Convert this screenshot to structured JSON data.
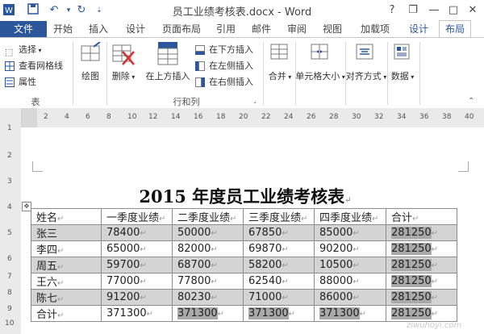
{
  "window": {
    "title": "员工业绩考核表.docx - Word"
  },
  "qat": {
    "save_icon": "floppy-disk-icon",
    "undo_icon": "undo-icon",
    "redo_icon": "redo-icon"
  },
  "window_controls": {
    "help": "?",
    "restore": "❐",
    "minimize": "—",
    "maximize": "□",
    "close": "✕"
  },
  "tabs": [
    {
      "label": "文件"
    },
    {
      "label": "开始"
    },
    {
      "label": "插入"
    },
    {
      "label": "设计"
    },
    {
      "label": "页面布局"
    },
    {
      "label": "引用"
    },
    {
      "label": "邮件"
    },
    {
      "label": "审阅"
    },
    {
      "label": "视图"
    },
    {
      "label": "加载项"
    },
    {
      "label": "设计"
    },
    {
      "label": "布局"
    }
  ],
  "ribbon": {
    "table_group": {
      "select": "选择",
      "view_gridlines": "查看网格线",
      "properties": "属性",
      "label": "表"
    },
    "draw": "绘图",
    "delete": "删除",
    "insert_above": "在上方插入",
    "insert_below": "在下方插入",
    "insert_left": "在左侧插入",
    "insert_right": "在右侧插入",
    "rows_cols_label": "行和列",
    "merge": "合并",
    "cell_size": "单元格大小",
    "alignment": "对齐方式",
    "data": "数据"
  },
  "ruler": {
    "h_ticks": [
      "2",
      "4",
      "6",
      "8",
      "10",
      "12",
      "14",
      "16",
      "18",
      "20",
      "22",
      "24",
      "26",
      "28",
      "30",
      "32",
      "34",
      "36",
      "38",
      "40"
    ],
    "v_ticks": [
      "1",
      "2",
      "3",
      "4",
      "5",
      "6",
      "7",
      "8",
      "9",
      "10",
      "11"
    ]
  },
  "document": {
    "title": "2015 年度员工业绩考核表",
    "headers": [
      "姓名",
      "一季度业绩",
      "二季度业绩",
      "三季度业绩",
      "四季度业绩",
      "合计"
    ],
    "rows": [
      [
        "张三",
        "78400",
        "50000",
        "67850",
        "85000",
        "281250"
      ],
      [
        "李四",
        "65000",
        "82000",
        "69870",
        "90200",
        "281250"
      ],
      [
        "周五",
        "59700",
        "68700",
        "58200",
        "10500",
        "281250"
      ],
      [
        "王六",
        "77000",
        "77800",
        "62540",
        "88000",
        "281250"
      ],
      [
        "陈七",
        "91200",
        "80230",
        "71000",
        "86000",
        "281250"
      ]
    ],
    "total_row": [
      "合计",
      "371300",
      "371300",
      "371300",
      "371300",
      "281250"
    ],
    "paragraph_mark": "↵"
  },
  "colors": {
    "accent": "#2b579a",
    "shade": "#d4d4d4"
  },
  "watermark": "ziwuhoyi.com"
}
